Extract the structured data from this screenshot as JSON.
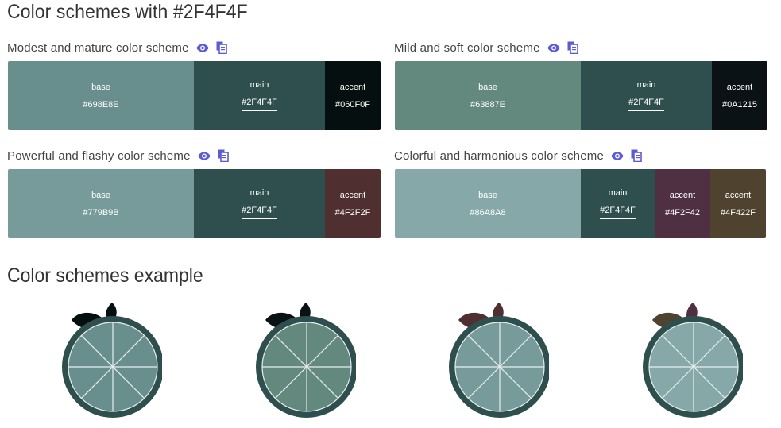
{
  "page_title": "Color schemes with #2F4F4F",
  "examples_title": "Color schemes example",
  "icons": {
    "view": "eye-icon",
    "copy": "copy-icon"
  },
  "schemes": [
    {
      "title": "Modest and mature color scheme",
      "swatches": [
        {
          "label": "base",
          "hex": "#698E8E",
          "color": "#698E8E"
        },
        {
          "label": "main",
          "hex": "#2F4F4F",
          "color": "#2F4F4F"
        },
        {
          "label": "accent",
          "hex": "#060F0F",
          "color": "#060F0F"
        }
      ]
    },
    {
      "title": "Mild and soft color scheme",
      "swatches": [
        {
          "label": "base",
          "hex": "#63887E",
          "color": "#63887E"
        },
        {
          "label": "main",
          "hex": "#2F4F4F",
          "color": "#2F4F4F"
        },
        {
          "label": "accent",
          "hex": "#0A1215",
          "color": "#0A1215"
        }
      ]
    },
    {
      "title": "Powerful and flashy color scheme",
      "swatches": [
        {
          "label": "base",
          "hex": "#779B9B",
          "color": "#779B9B"
        },
        {
          "label": "main",
          "hex": "#2F4F4F",
          "color": "#2F4F4F"
        },
        {
          "label": "accent",
          "hex": "#4F2F2F",
          "color": "#4F2F2F"
        }
      ]
    },
    {
      "title": "Colorful and harmonious color scheme",
      "swatches": [
        {
          "label": "base",
          "hex": "#86A8A8",
          "color": "#86A8A8"
        },
        {
          "label": "main",
          "hex": "#2F4F4F",
          "color": "#2F4F4F"
        },
        {
          "label": "accent",
          "hex": "#4F2F42",
          "color": "#4F2F42"
        },
        {
          "label": "accent",
          "hex": "#4F422F",
          "color": "#4F422F"
        }
      ]
    }
  ],
  "fruits": [
    {
      "rind": "#2F4F4F",
      "flesh": "#698E8E",
      "leaf": "#060F0F",
      "leaf2": "#060F0F"
    },
    {
      "rind": "#2F4F4F",
      "flesh": "#63887E",
      "leaf": "#0A1215",
      "leaf2": "#0A1215"
    },
    {
      "rind": "#2F4F4F",
      "flesh": "#779B9B",
      "leaf": "#4F2F2F",
      "leaf2": "#4F2F2F"
    },
    {
      "rind": "#2F4F4F",
      "flesh": "#86A8A8",
      "leaf": "#4F422F",
      "leaf2": "#4F2F42"
    }
  ]
}
